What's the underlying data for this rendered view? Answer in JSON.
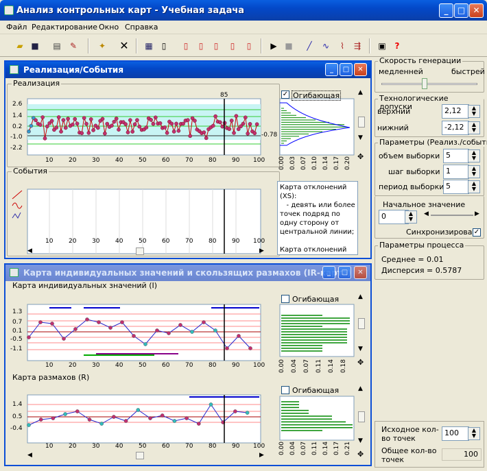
{
  "app": {
    "title": "Анализ контрольных карт - Учебная задача"
  },
  "menu": [
    "Файл",
    "Редактирование",
    "Окно",
    "Справка"
  ],
  "win1": {
    "title": "Реализация/События",
    "realiz_label": "Реализация",
    "cursor_value": "85",
    "right_value": "-0.78",
    "y_ticks": [
      "2.6",
      "1.4",
      "0.2",
      "-1.0",
      "-2.2"
    ],
    "x_ticks": [
      "10",
      "20",
      "30",
      "40",
      "50",
      "60",
      "70",
      "80",
      "90",
      "100"
    ],
    "envelope_label": "Огибающая",
    "hist_ticks": [
      "0.00",
      "0.03",
      "0.07",
      "0.10",
      "0.14",
      "0.17",
      "0.20"
    ],
    "events_label": "События",
    "events_text": "Карта отклонений (XS):\n   - девять или более точек подряд по одну сторону от центральной линии;\n\nКарта отклонений (MS):\n   - девять или более точек подряд по одну"
  },
  "win2": {
    "title": "Карта индивидуальных значений и скользящих размахов (IR-карта)",
    "ind_label": "Карта индивидуальных значений (I)",
    "ind_y_ticks": [
      "1.3",
      "0.7",
      "0.1",
      "-0.5",
      "-1.1"
    ],
    "x_ticks": [
      "10",
      "20",
      "30",
      "40",
      "50",
      "60",
      "70",
      "80",
      "90",
      "100"
    ],
    "envelope_label": "Огибающая",
    "hist1_ticks": [
      "0.00",
      "0.04",
      "0.07",
      "0.11",
      "0.14",
      "0.18"
    ],
    "range_label": "Карта размахов (R)",
    "range_y_ticks": [
      "1.4",
      "0.5",
      "-0.4"
    ],
    "hist2_ticks": [
      "0.00",
      "0.04",
      "0.07",
      "0.11",
      "0.14",
      "0.17",
      "0.21"
    ]
  },
  "right": {
    "speed_label": "Скорость генерации",
    "slow": "медленней",
    "fast": "быстрей",
    "speed_value": 0.45,
    "tol_label": "Технологические допуски",
    "upper_label": "верхний",
    "upper_value": "2,12",
    "lower_label": "нижний",
    "lower_value": "-2,12",
    "params_label": "Параметры (Реализ./события)",
    "sample_size_label": "объем выборки",
    "sample_size": "5",
    "step_label": "шаг  выборки",
    "step": "1",
    "period_label": "период  выборки",
    "period": "5",
    "init_label": "Начальное значение",
    "init_value": "0",
    "sync_label": "Синхронизировать",
    "proc_label": "Параметры процесса",
    "mean": "Среднее = 0.01",
    "disp": "Дисперсия = 0.5787",
    "src_label": "Исходное кол-во точек",
    "src_value": "100",
    "total_label": "Общее кол-во точек",
    "total_value": "100"
  }
}
